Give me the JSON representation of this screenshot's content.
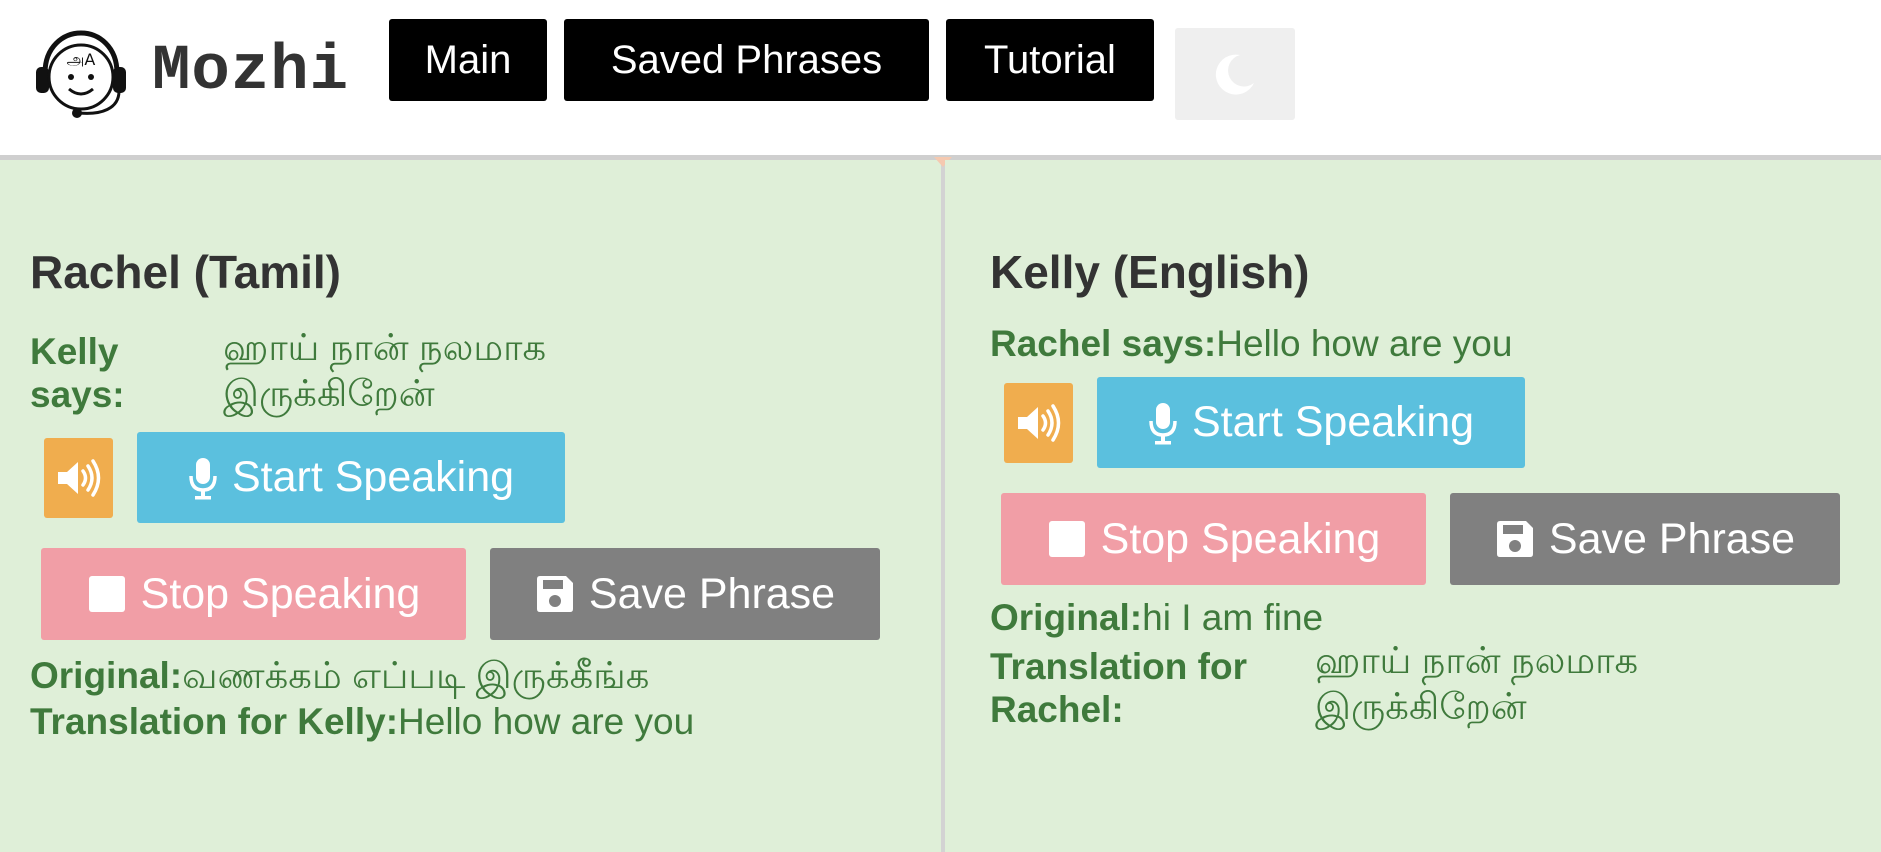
{
  "header": {
    "brand": "Mozhi",
    "logo_glyph": "அA",
    "nav": {
      "main": "Main",
      "saved": "Saved Phrases",
      "tutorial": "Tutorial"
    },
    "theme_icon": "moon-icon"
  },
  "left_pane": {
    "heading": "Rachel (Tamil)",
    "says_label_line1": "Kelly",
    "says_label_line2": "says:",
    "says_text_line1": "ஹாய் நான் நலமாக",
    "says_text_line2": "இருக்கிறேன்",
    "buttons": {
      "start": "Start Speaking",
      "stop": "Stop Speaking",
      "save": "Save Phrase"
    },
    "original_label": "Original:",
    "original_text": "வணக்கம் எப்படி இருக்கீங்க",
    "translation_label": "Translation for Kelly:",
    "translation_text": "Hello how are you"
  },
  "right_pane": {
    "heading": "Kelly (English)",
    "says_label": "Rachel says:",
    "says_text": "Hello how are you",
    "buttons": {
      "start": "Start Speaking",
      "stop": "Stop Speaking",
      "save": "Save Phrase"
    },
    "original_label": "Original:",
    "original_text": "hi I am fine",
    "translation_label_line1": "Translation for",
    "translation_label_line2": "Rachel:",
    "translation_text_line1": "ஹாய் நான் நலமாக",
    "translation_text_line2": "இருக்கிறேன்"
  },
  "colors": {
    "pane_bg": "#dfefd8",
    "label_green": "#3f7a3c",
    "speaker": "#f0ad4e",
    "start": "#5bc0de",
    "stop": "#f19ea6",
    "save": "#808080",
    "nav": "#000000"
  },
  "icons": [
    "volume-icon",
    "microphone-icon",
    "stop-square-icon",
    "floppy-disk-icon",
    "moon-icon"
  ]
}
